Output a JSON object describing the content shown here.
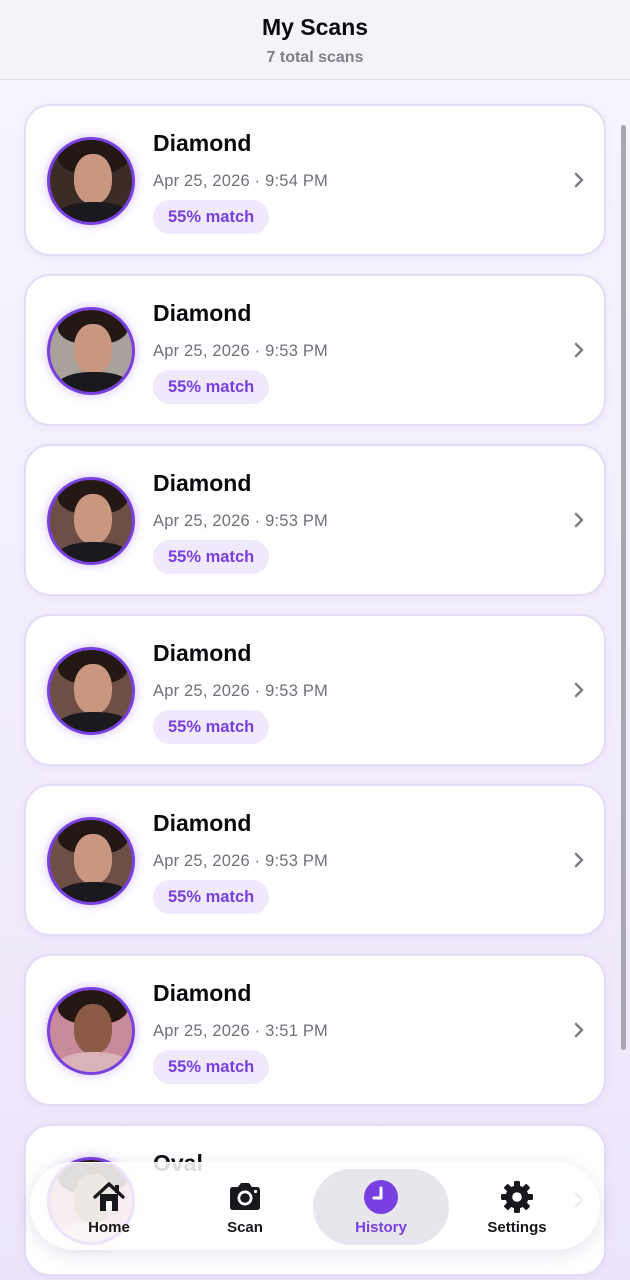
{
  "header": {
    "title": "My Scans",
    "subtitle": "7 total scans"
  },
  "scans": [
    {
      "name": "Diamond",
      "date": "Apr 25, 2026 · 9:54 PM",
      "match": "55% match"
    },
    {
      "name": "Diamond",
      "date": "Apr 25, 2026 · 9:53 PM",
      "match": "55% match"
    },
    {
      "name": "Diamond",
      "date": "Apr 25, 2026 · 9:53 PM",
      "match": "55% match"
    },
    {
      "name": "Diamond",
      "date": "Apr 25, 2026 · 9:53 PM",
      "match": "55% match"
    },
    {
      "name": "Diamond",
      "date": "Apr 25, 2026 · 9:53 PM",
      "match": "55% match"
    },
    {
      "name": "Diamond",
      "date": "Apr 25, 2026 · 3:51 PM",
      "match": "55% match"
    },
    {
      "name": "Oval",
      "date": "",
      "match": ""
    }
  ],
  "tabbar": {
    "items": [
      {
        "label": "Home",
        "icon": "home-icon",
        "active": false
      },
      {
        "label": "Scan",
        "icon": "camera-icon",
        "active": false
      },
      {
        "label": "History",
        "icon": "clock-icon",
        "active": true
      },
      {
        "label": "Settings",
        "icon": "gear-icon",
        "active": false
      }
    ]
  },
  "colors": {
    "accent": "#7a3fe0",
    "badge_bg": "#efe9fb",
    "card_border": "#e4dcf6",
    "background": "#f2eefb"
  }
}
